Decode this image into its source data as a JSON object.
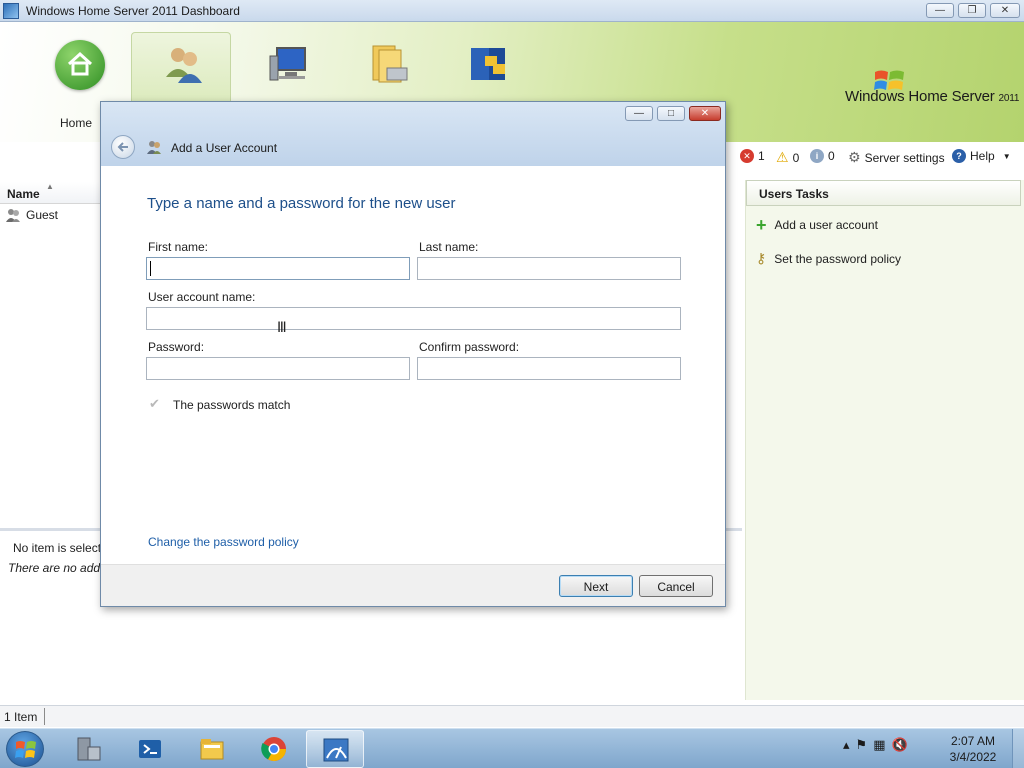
{
  "dashboard": {
    "window_title": "Windows Home Server 2011 Dashboard",
    "nav": {
      "home_label": "Home"
    },
    "brand": {
      "name": "Windows Home Server",
      "year": "2011"
    },
    "status": {
      "critical_count": "1",
      "warning_count": "0",
      "info_count": "0",
      "server_settings": "Server settings",
      "help": "Help"
    },
    "list": {
      "column_name": "Name",
      "rows": [
        {
          "name": "Guest"
        }
      ]
    },
    "details": {
      "no_item": "No item is select",
      "none_line": "There are no addi"
    },
    "tasks": {
      "header": "Users Tasks",
      "items": [
        {
          "label": "Add a user account",
          "icon": "green-plus-icon"
        },
        {
          "label": "Set the password policy",
          "icon": "key-icon"
        }
      ]
    },
    "statusbar": {
      "item_count": "1 Item"
    }
  },
  "dialog": {
    "title": "Add a User Account",
    "heading": "Type a name and a password for the new user",
    "fields": {
      "first_name": {
        "label": "First name:",
        "value": ""
      },
      "last_name": {
        "label": "Last name:",
        "value": ""
      },
      "account_name": {
        "label": "User account name:",
        "value": ""
      },
      "password": {
        "label": "Password:",
        "value": ""
      },
      "confirm_password": {
        "label": "Confirm password:",
        "value": ""
      }
    },
    "match_message": "The passwords match",
    "policy_link": "Change the password policy",
    "buttons": {
      "next": "Next",
      "cancel": "Cancel"
    }
  },
  "taskbar": {
    "clock_time": "2:07 AM",
    "clock_date": "3/4/2022",
    "pinned": [
      "server-manager-icon",
      "powershell-icon",
      "file-explorer-icon",
      "chrome-icon",
      "dashboard-icon"
    ]
  },
  "colors": {
    "heading_blue": "#1d4f8a",
    "link_blue": "#1f5fa8",
    "header_green": "#b4d36e",
    "tasks_bg": "#f4f8eb"
  }
}
